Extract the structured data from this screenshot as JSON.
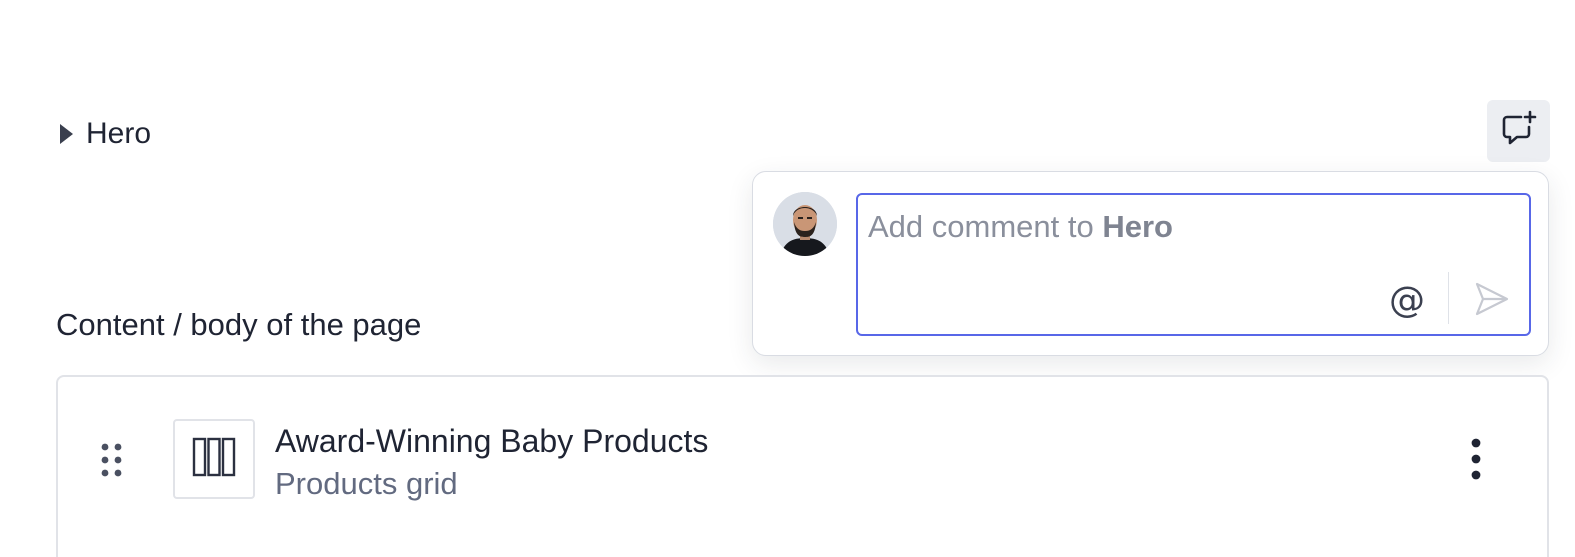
{
  "hero": {
    "label": "Hero"
  },
  "comment": {
    "placeholder_prefix": "Add comment to ",
    "placeholder_target": "Hero",
    "mention_symbol": "@"
  },
  "section": {
    "title": "Content / body of the page"
  },
  "block": {
    "title": "Award-Winning Baby Products",
    "subtitle": "Products grid"
  },
  "colors": {
    "accent": "#5867e8",
    "text": "#1f2433",
    "muted": "#626a80"
  },
  "icons": {
    "hero_toggle": "caret-right-icon",
    "add_comment": "comment-plus-icon",
    "mention": "at-icon",
    "send": "send-icon",
    "drag": "drag-handle-icon",
    "block_type": "columns-icon",
    "menu": "more-vertical-icon"
  }
}
